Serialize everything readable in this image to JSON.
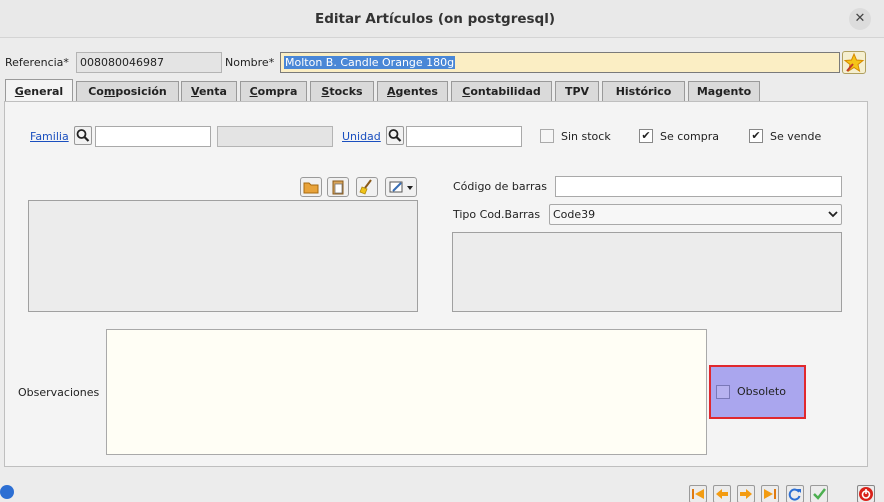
{
  "window": {
    "title": "Editar Artículos (on postgresql)",
    "close_glyph": "✕"
  },
  "header": {
    "referencia_label": "Referencia*",
    "referencia_value": "008080046987",
    "nombre_label": "Nombre*",
    "nombre_value": "Molton B. Candle Orange 180g"
  },
  "tabs": [
    {
      "pre": "",
      "key": "G",
      "rest": "eneral"
    },
    {
      "pre": "Co",
      "key": "m",
      "rest": "posición"
    },
    {
      "pre": "",
      "key": "V",
      "rest": "enta"
    },
    {
      "pre": "",
      "key": "C",
      "rest": "ompra"
    },
    {
      "pre": "",
      "key": "S",
      "rest": "tocks"
    },
    {
      "pre": "",
      "key": "A",
      "rest": "gentes"
    },
    {
      "pre": "",
      "key": "C",
      "rest": "ontabilidad"
    },
    {
      "pre": "",
      "key": "",
      "rest": "TPV"
    },
    {
      "pre": "",
      "key": "",
      "rest": "Histórico"
    },
    {
      "pre": "",
      "key": "",
      "rest": "Magento"
    }
  ],
  "general": {
    "familia_label": "Familia",
    "familia_value": "",
    "familia_desc": "",
    "unidad_label": "Unidad",
    "unidad_value": "",
    "sin_stock_label": "Sin stock",
    "se_compra_label": "Se compra",
    "se_vende_label": "Se vende",
    "codigo_barras_label": "Código de barras",
    "codigo_barras_value": "",
    "tipo_cod_label": "Tipo Cod.Barras",
    "tipo_cod_value": "Code39",
    "observaciones_label": "Observaciones",
    "obsoleto_label": "Obsoleto",
    "check_glyph": "✔"
  },
  "colors": {
    "highlight_fill": "#aaa6ee",
    "highlight_border": "#e0282e",
    "nombre_bg": "#fbeec4"
  }
}
